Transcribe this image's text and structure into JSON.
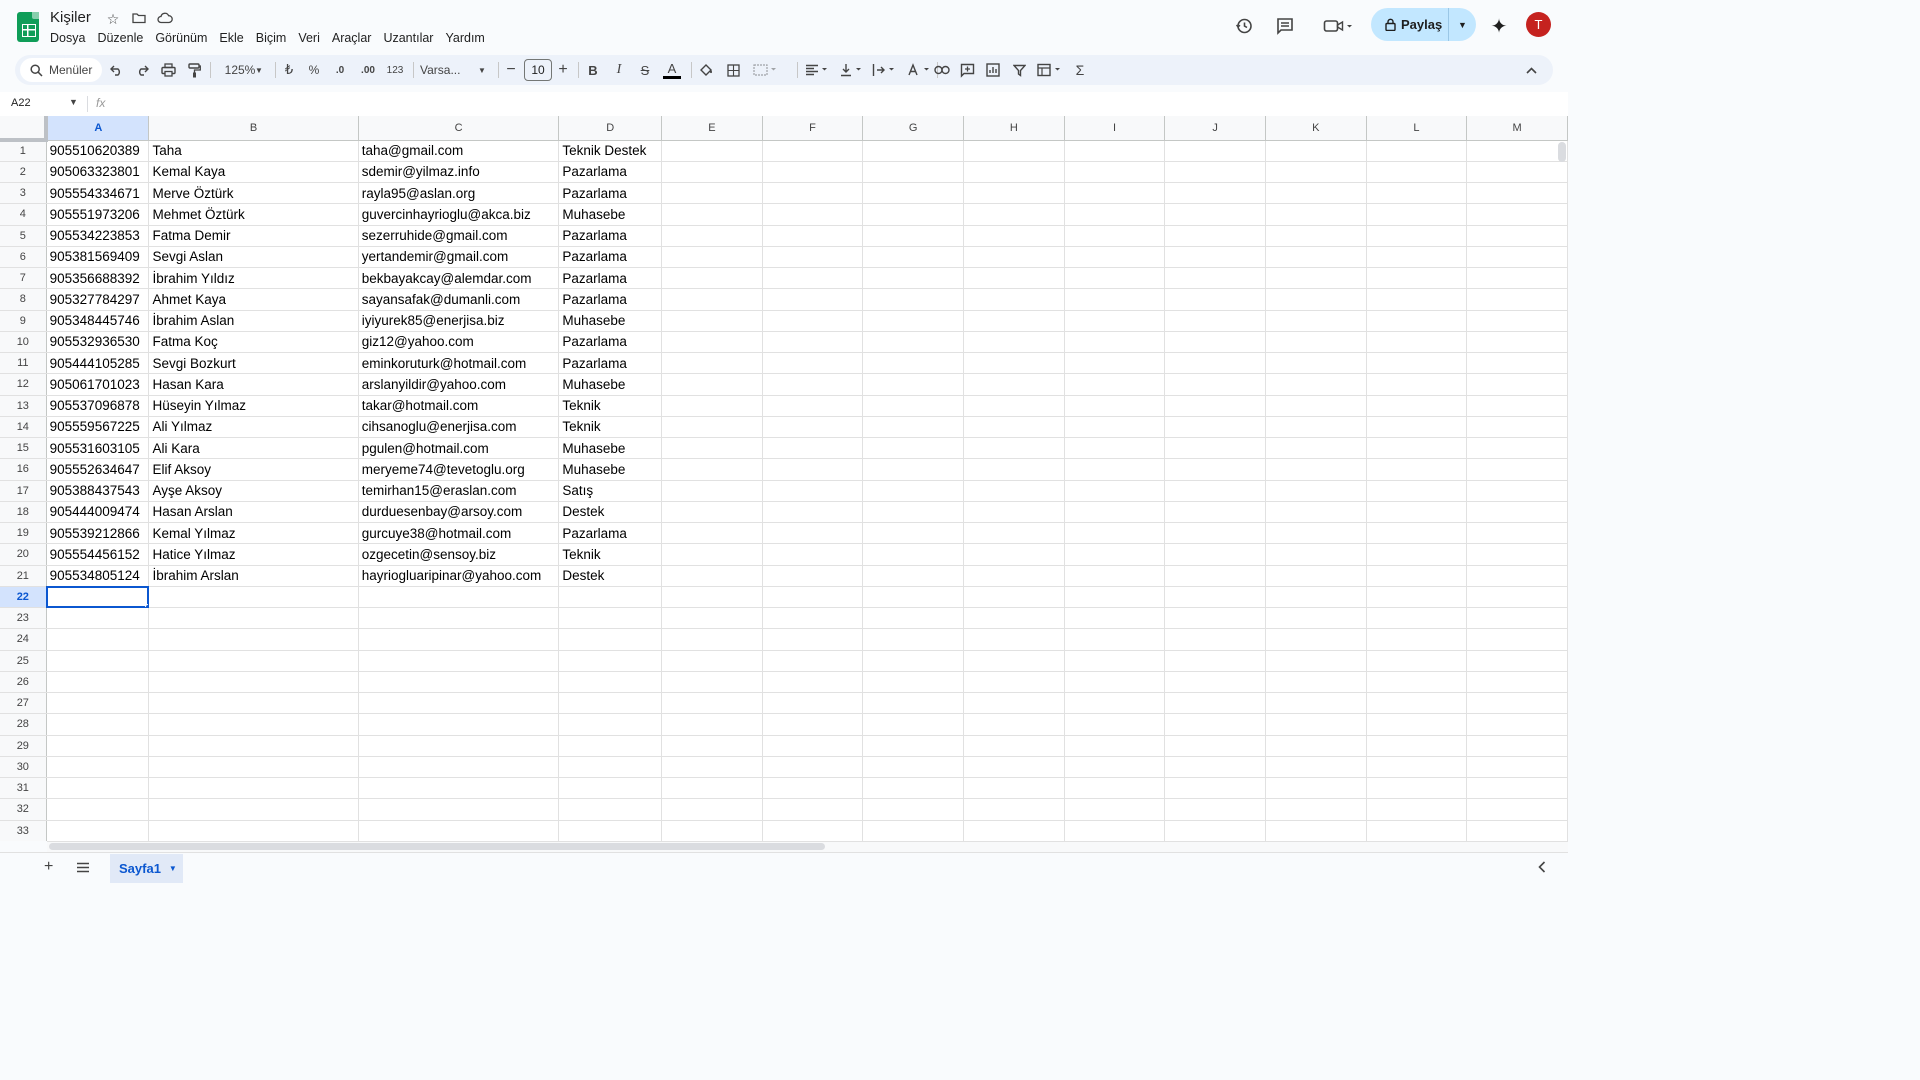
{
  "app": {
    "title": "Kişiler"
  },
  "menu": [
    "Dosya",
    "Düzenle",
    "Görünüm",
    "Ekle",
    "Biçim",
    "Veri",
    "Araçlar",
    "Uzantılar",
    "Yardım"
  ],
  "header": {
    "share_label": "Paylaş",
    "avatar_initial": "T"
  },
  "toolbar": {
    "search_label": "Menüler",
    "zoom": "125%",
    "currency": "₺",
    "percent": "%",
    "decimal_decrease": ".0",
    "decimal_increase": ".00",
    "number_format": "123",
    "font": "Varsa...",
    "font_size": "10"
  },
  "formula_bar": {
    "name_box": "A22",
    "fx": "fx",
    "value": ""
  },
  "columns": [
    "A",
    "B",
    "C",
    "D",
    "E",
    "F",
    "G",
    "H",
    "I",
    "J",
    "K",
    "L",
    "M"
  ],
  "rows": [
    [
      "905510620389",
      "Taha",
      "taha@gmail.com",
      "Teknik Destek"
    ],
    [
      "905063323801",
      "Kemal Kaya",
      "sdemir@yilmaz.info",
      "Pazarlama"
    ],
    [
      "905554334671",
      "Merve Öztürk",
      "rayla95@aslan.org",
      "Pazarlama"
    ],
    [
      "905551973206",
      "Mehmet Öztürk",
      "guvercinhayrioglu@akca.biz",
      "Muhasebe"
    ],
    [
      "905534223853",
      "Fatma Demir",
      "sezerruhide@gmail.com",
      "Pazarlama"
    ],
    [
      "905381569409",
      "Sevgi Aslan",
      "yertandemir@gmail.com",
      "Pazarlama"
    ],
    [
      "905356688392",
      "İbrahim Yıldız",
      "bekbayakcay@alemdar.com",
      "Pazarlama"
    ],
    [
      "905327784297",
      "Ahmet Kaya",
      "sayansafak@dumanli.com",
      "Pazarlama"
    ],
    [
      "905348445746",
      "İbrahim Aslan",
      "iyiyurek85@enerjisa.biz",
      "Muhasebe"
    ],
    [
      "905532936530",
      "Fatma Koç",
      "giz12@yahoo.com",
      "Pazarlama"
    ],
    [
      "905444105285",
      "Sevgi Bozkurt",
      "eminkoruturk@hotmail.com",
      "Pazarlama"
    ],
    [
      "905061701023",
      "Hasan Kara",
      "arslanyildir@yahoo.com",
      "Muhasebe"
    ],
    [
      "905537096878",
      "Hüseyin Yılmaz",
      "takar@hotmail.com",
      "Teknik"
    ],
    [
      "905559567225",
      "Ali Yılmaz",
      "cihsanoglu@enerjisa.com",
      "Teknik"
    ],
    [
      "905531603105",
      "Ali Kara",
      "pgulen@hotmail.com",
      "Muhasebe"
    ],
    [
      "905552634647",
      "Elif Aksoy",
      "meryeme74@tevetoglu.org",
      "Muhasebe"
    ],
    [
      "905388437543",
      "Ayşe Aksoy",
      "temirhan15@eraslan.com",
      "Satış"
    ],
    [
      "905444009474",
      "Hasan Arslan",
      "durduesenbay@arsoy.com",
      "Destek"
    ],
    [
      "905539212866",
      "Kemal Yılmaz",
      "gurcuye38@hotmail.com",
      "Pazarlama"
    ],
    [
      "905554456152",
      "Hatice Yılmaz",
      "ozgecetin@sensoy.biz",
      "Teknik"
    ],
    [
      "905534805124",
      "İbrahim Arslan",
      "hayriogluaripinar@yahoo.com",
      "Destek"
    ]
  ],
  "visible_row_count": 33,
  "active_cell": "A22",
  "sheet_tabs": [
    "Sayfa1"
  ],
  "colors": {
    "accent": "#0b57d0",
    "share_bg": "#c2e7ff",
    "avatar": "#c5221f",
    "sheets_green": "#0f9d58"
  }
}
